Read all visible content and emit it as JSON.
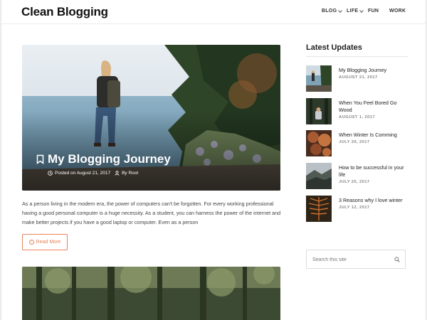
{
  "site": {
    "title": "Clean Blogging"
  },
  "nav": [
    {
      "label": "BLOG",
      "dropdown": true
    },
    {
      "label": "LIFE",
      "dropdown": true
    },
    {
      "label": "FUN",
      "dropdown": false
    },
    {
      "label": "WORK",
      "dropdown": false
    }
  ],
  "featured": {
    "title": "My Blogging Journey",
    "posted": "Posted on August 21, 2017",
    "author": "By Root",
    "excerpt": "As a person living in the modern era, the power of computers can't be forgotten. For every working professional having a good personal computer is a huge necessity. As a student, you can harness the power of the internet and make better projects if you have a good laptop or computer. Even as a person",
    "read_more": "Read More"
  },
  "sidebar": {
    "heading": "Latest Updates",
    "items": [
      {
        "title": "My Blogging Journey",
        "date": "AUGUST 21, 2017"
      },
      {
        "title": "When You Feel Bored Go Wood",
        "date": "AUGUST 1, 2017"
      },
      {
        "title": "When Winter Is Comming",
        "date": "JULY 29, 2017"
      },
      {
        "title": "How to be successful in your life",
        "date": "JULY 25, 2017"
      },
      {
        "title": "3 Reasons why I love winter",
        "date": "JULY 12, 2017"
      }
    ],
    "search_placeholder": "Search this site"
  },
  "colors": {
    "accent": "#e8835a",
    "text": "#333333"
  }
}
